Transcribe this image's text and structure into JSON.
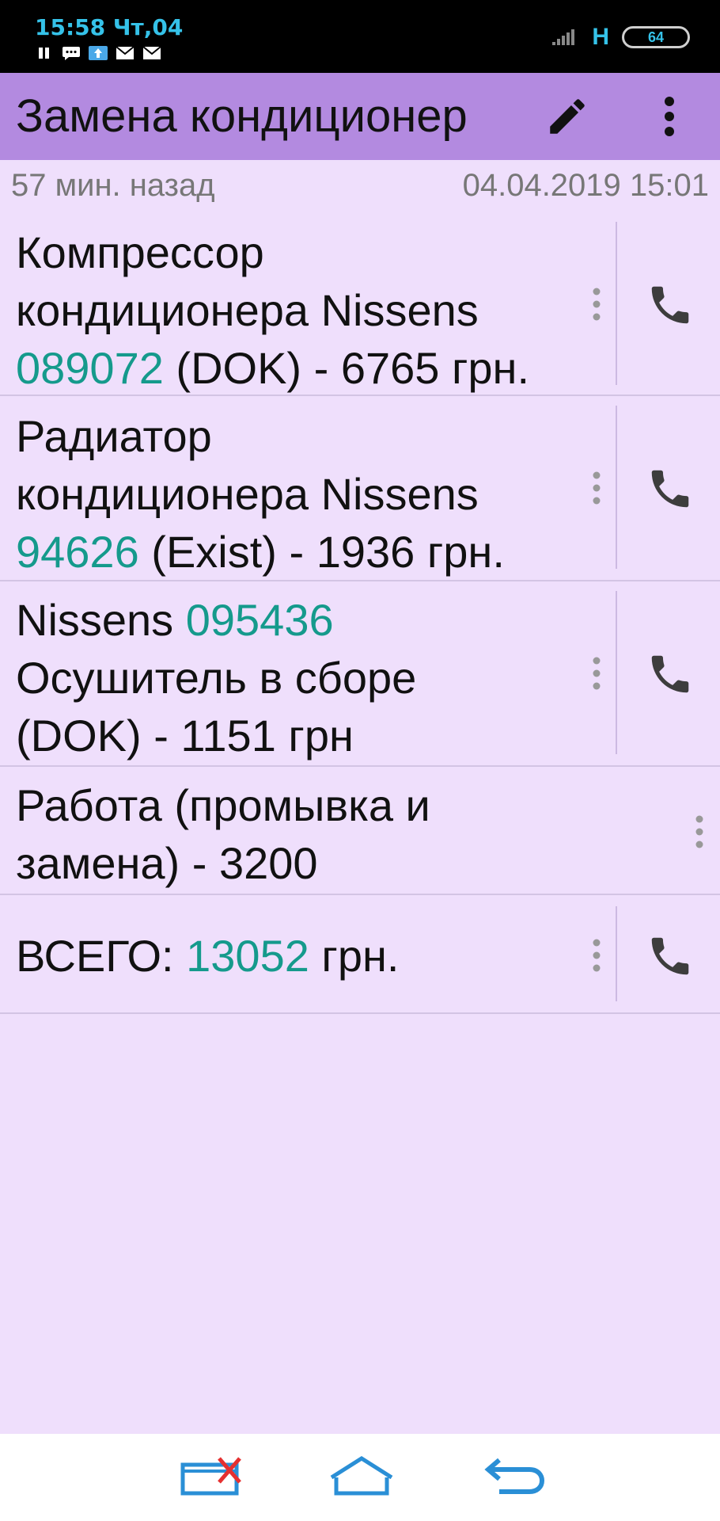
{
  "status_bar": {
    "time": "15:58 Чт,04",
    "network": "H",
    "battery": "64"
  },
  "appbar": {
    "title": "Замена кондиционер",
    "edit_icon": "pencil-icon",
    "more_icon": "more-vertical-icon"
  },
  "meta": {
    "relative_time": "57 мин. назад",
    "date": "04.04.2019 15:01"
  },
  "items": [
    {
      "line1": "Компрессор",
      "line2": "кондиционера Nissens",
      "num": "089072",
      "rest": " (DOK) - 6765 грн."
    },
    {
      "line1": "Радиатор",
      "line2": "кондиционера Nissens",
      "num": "94626",
      "rest": " (Exist) - 1936 грн."
    },
    {
      "pre": "Nissens ",
      "num": "095436",
      "line2": "Осушитель в сборе",
      "line3": "(DOK) - 1151 грн"
    },
    {
      "line1": "Работа (промывка и",
      "line2": "замена) - 3200"
    },
    {
      "pre": "ВСЕГО: ",
      "num": "13052",
      "rest": " грн."
    }
  ],
  "colors": {
    "appbar": "#b38ae0",
    "background": "#efdffc",
    "number": "#159a8c",
    "status_accent": "#35c2e9"
  },
  "navbar": {
    "recent_icon": "recent-apps-icon",
    "home_icon": "home-icon",
    "back_icon": "back-icon"
  }
}
